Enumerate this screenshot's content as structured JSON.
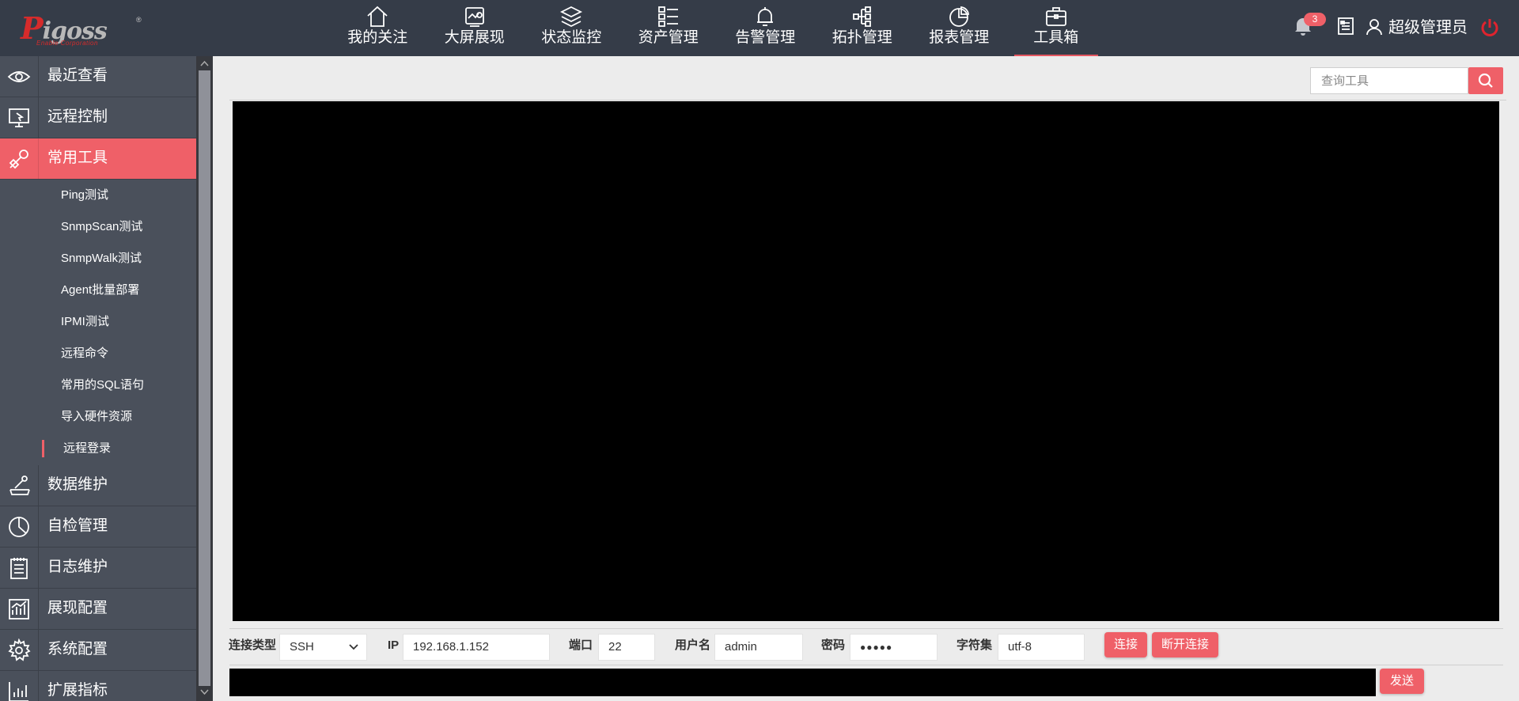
{
  "header": {
    "logo_text": "igoss",
    "logo_mark": "P",
    "logo_sub": "Enable Corporation",
    "nav": [
      {
        "label": "我的关注",
        "icon": "home-icon"
      },
      {
        "label": "大屏展现",
        "icon": "screen-display-icon"
      },
      {
        "label": "状态监控",
        "icon": "layers-icon"
      },
      {
        "label": "资产管理",
        "icon": "list-icon"
      },
      {
        "label": "告警管理",
        "icon": "bell-icon"
      },
      {
        "label": "拓扑管理",
        "icon": "topology-icon"
      },
      {
        "label": "报表管理",
        "icon": "pie-chart-icon"
      },
      {
        "label": "工具箱",
        "icon": "toolbox-icon",
        "active": true
      }
    ],
    "notification_count": "3",
    "user_name": "超级管理员",
    "accent_color": "#ef6068"
  },
  "sidebar": {
    "items": [
      {
        "label": "最近查看",
        "icon": "eye-icon"
      },
      {
        "label": "远程控制",
        "icon": "remote-desktop-icon"
      },
      {
        "label": "常用工具",
        "icon": "tools-icon",
        "active": true
      },
      {
        "label": "数据维护",
        "icon": "wrench-disk-icon"
      },
      {
        "label": "自检管理",
        "icon": "pie-chart-icon"
      },
      {
        "label": "日志维护",
        "icon": "clipboard-icon"
      },
      {
        "label": "展现配置",
        "icon": "chart-icon"
      },
      {
        "label": "系统配置",
        "icon": "gear-icon"
      },
      {
        "label": "扩展指标",
        "icon": "bar-chart-icon"
      }
    ],
    "sub_items": [
      {
        "label": "Ping测试"
      },
      {
        "label": "SnmpScan测试"
      },
      {
        "label": "SnmpWalk测试"
      },
      {
        "label": "Agent批量部署"
      },
      {
        "label": "IPMI测试"
      },
      {
        "label": "远程命令"
      },
      {
        "label": "常用的SQL语句"
      },
      {
        "label": "导入硬件资源"
      },
      {
        "label": "远程登录",
        "active": true
      }
    ]
  },
  "toolbar": {
    "search_placeholder": "查询工具"
  },
  "connection": {
    "type_label": "连接类型",
    "type_value": "SSH",
    "ip_label": "IP",
    "ip_value": "192.168.1.152",
    "port_label": "端口",
    "port_value": "22",
    "user_label": "用户名",
    "user_value": "admin",
    "password_label": "密码",
    "password_value": "●●●●●",
    "charset_label": "字符集",
    "charset_value": "utf-8",
    "connect_label": "连接",
    "disconnect_label": "断开连接",
    "send_label": "发送"
  }
}
